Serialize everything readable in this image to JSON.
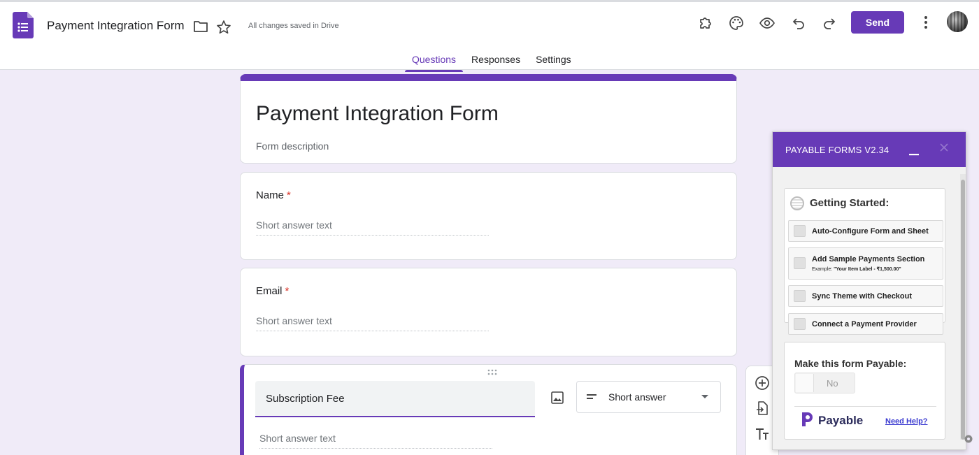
{
  "app": {
    "title": "Payment Integration Form",
    "save_status": "All changes saved in Drive",
    "accent": "#673ab7",
    "background": "#f0ebf8"
  },
  "header": {
    "send_label": "Send",
    "icons": [
      "addon-puzzle-icon",
      "palette-icon",
      "preview-eye-icon",
      "undo-icon",
      "redo-icon",
      "more-vert-icon"
    ]
  },
  "tabs": [
    {
      "label": "Questions",
      "active": true
    },
    {
      "label": "Responses",
      "active": false
    },
    {
      "label": "Settings",
      "active": false
    }
  ],
  "form": {
    "title": "Payment Integration Form",
    "description_placeholder": "Form description",
    "questions": [
      {
        "label": "Name",
        "required": "*",
        "placeholder": "Short answer text"
      },
      {
        "label": "Email",
        "required": "*",
        "placeholder": "Short answer text"
      }
    ],
    "active_question": {
      "title": "Subscription Fee",
      "type": "Short answer",
      "placeholder": "Short answer text"
    }
  },
  "payable_panel": {
    "title": "PAYABLE FORMS V2.34",
    "getting_started": "Getting Started:",
    "steps": [
      {
        "label": "Auto-Configure Form and Sheet"
      },
      {
        "label": "Add Sample Payments Section",
        "sub_prefix": "Example: ",
        "sub_example": "\"Your Item Label - ₹1,500.00\""
      },
      {
        "label": "Sync Theme with Checkout"
      },
      {
        "label": "Connect a Payment Provider"
      }
    ],
    "make_payable": "Make this form Payable:",
    "toggle_value": "No",
    "brand": "Payable",
    "help": "Need Help?"
  }
}
